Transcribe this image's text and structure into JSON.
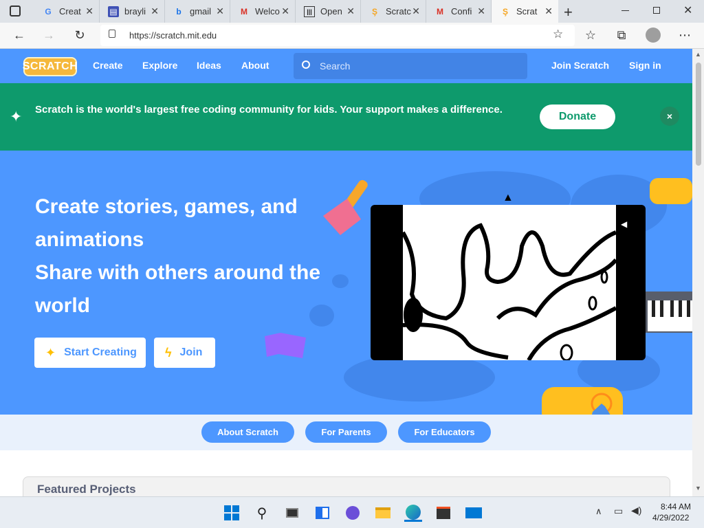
{
  "tabs": [
    {
      "title": "Creat",
      "icon": "google-icon"
    },
    {
      "title": "brayli",
      "icon": "forms-icon"
    },
    {
      "title": "gmail",
      "icon": "bing-icon"
    },
    {
      "title": "Welco",
      "icon": "gmail-icon"
    },
    {
      "title": "Open",
      "icon": "library-icon"
    },
    {
      "title": "Scratc",
      "icon": "scratch-icon"
    },
    {
      "title": "Confi",
      "icon": "gmail-icon"
    },
    {
      "title": "Scrat",
      "icon": "scratch-icon"
    }
  ],
  "browser": {
    "url": "https://scratch.mit.edu"
  },
  "nav": {
    "logo": "SCRATCH",
    "links": [
      "Create",
      "Explore",
      "Ideas",
      "About"
    ],
    "search_placeholder": "Search",
    "join": "Join Scratch",
    "signin": "Sign in"
  },
  "donate": {
    "message": "Scratch is the world's largest free coding community for kids. Your support makes a difference.",
    "button": "Donate",
    "close_glyph": "×"
  },
  "hero": {
    "lines": [
      "Create stories, games, and",
      "animations",
      "Share with others around the",
      "world"
    ],
    "start_creating": "Start Creating",
    "join": "Join"
  },
  "pills": [
    "About Scratch",
    "For Parents",
    "For Educators"
  ],
  "featured": {
    "title": "Featured Projects"
  },
  "taskbar": {
    "time": "8:44 AM",
    "date": "4/29/2022"
  },
  "colors": {
    "scratch_blue": "#4d97ff",
    "donate_green": "#0e9a6c",
    "scratch_orange": "#f5b83c"
  }
}
